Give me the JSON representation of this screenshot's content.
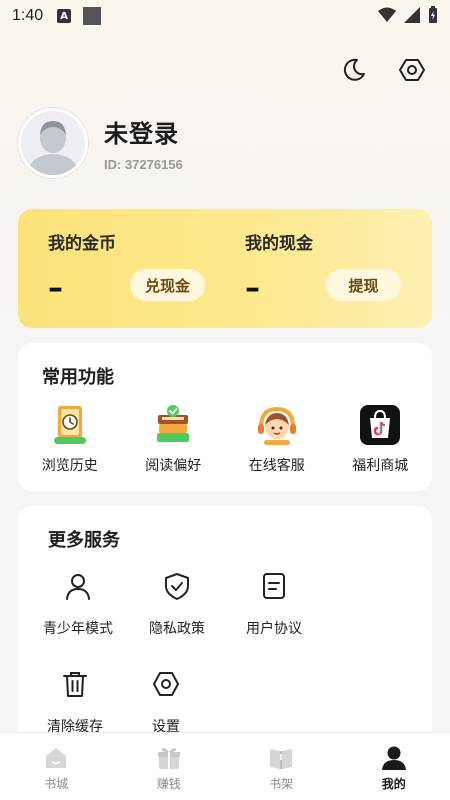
{
  "status": {
    "time": "1:40",
    "notif_glyph": "A"
  },
  "header": {
    "theme_icon": "moon-icon",
    "settings_icon": "gear-icon"
  },
  "profile": {
    "name": "未登录",
    "id": "ID: 37276156"
  },
  "wallet": {
    "coins_label": "我的金币",
    "coins_value": "–",
    "coins_button": "兑现金",
    "cash_label": "我的现金",
    "cash_value": "–",
    "cash_button": "提现",
    "accent": "#fbe27a"
  },
  "functions": {
    "title": "常用功能",
    "items": [
      {
        "label": "浏览历史",
        "icon": "history-clock-icon"
      },
      {
        "label": "阅读偏好",
        "icon": "book-stack-icon"
      },
      {
        "label": "在线客服",
        "icon": "customer-service-icon"
      },
      {
        "label": "福利商城",
        "icon": "tiktok-shop-icon"
      }
    ]
  },
  "services": {
    "title": "更多服务",
    "items": [
      {
        "label": "青少年模式",
        "icon": "person-icon"
      },
      {
        "label": "隐私政策",
        "icon": "shield-check-icon"
      },
      {
        "label": "用户协议",
        "icon": "document-icon"
      },
      {
        "label": "清除缓存",
        "icon": "trash-icon"
      },
      {
        "label": "设置",
        "icon": "gear-icon"
      }
    ]
  },
  "nav": {
    "items": [
      {
        "label": "书城",
        "icon": "home-icon"
      },
      {
        "label": "赚钱",
        "icon": "gift-icon"
      },
      {
        "label": "书架",
        "icon": "bookshelf-icon"
      },
      {
        "label": "我的",
        "icon": "user-icon"
      }
    ],
    "active": "我的"
  }
}
